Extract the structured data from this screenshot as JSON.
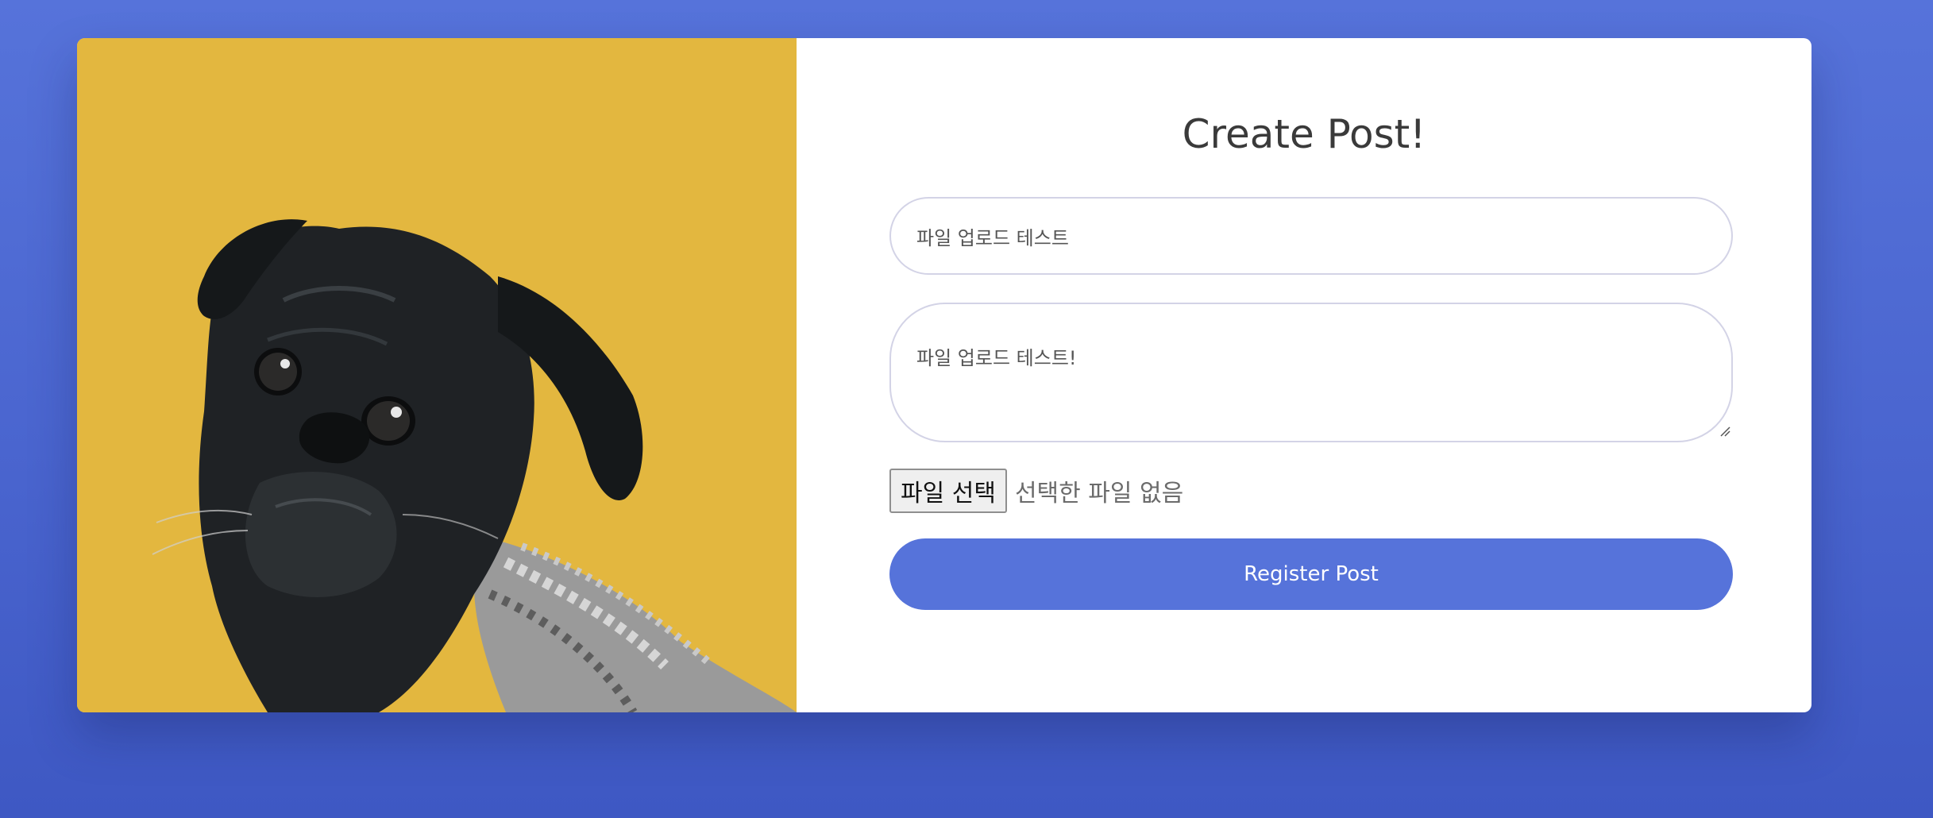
{
  "image": {
    "subject": "pug-photo",
    "background_color": "#e3b73f"
  },
  "form": {
    "title": "Create Post!",
    "title_field_value": "파일 업로드 테스트",
    "content_field_value": "파일 업로드 테스트!",
    "file_button_label": "파일 선택",
    "file_status": "선택한 파일 없음",
    "submit_label": "Register Post"
  },
  "colors": {
    "page_background": "#5673da",
    "button_background": "#5673da",
    "field_border": "#d3d3e6"
  }
}
